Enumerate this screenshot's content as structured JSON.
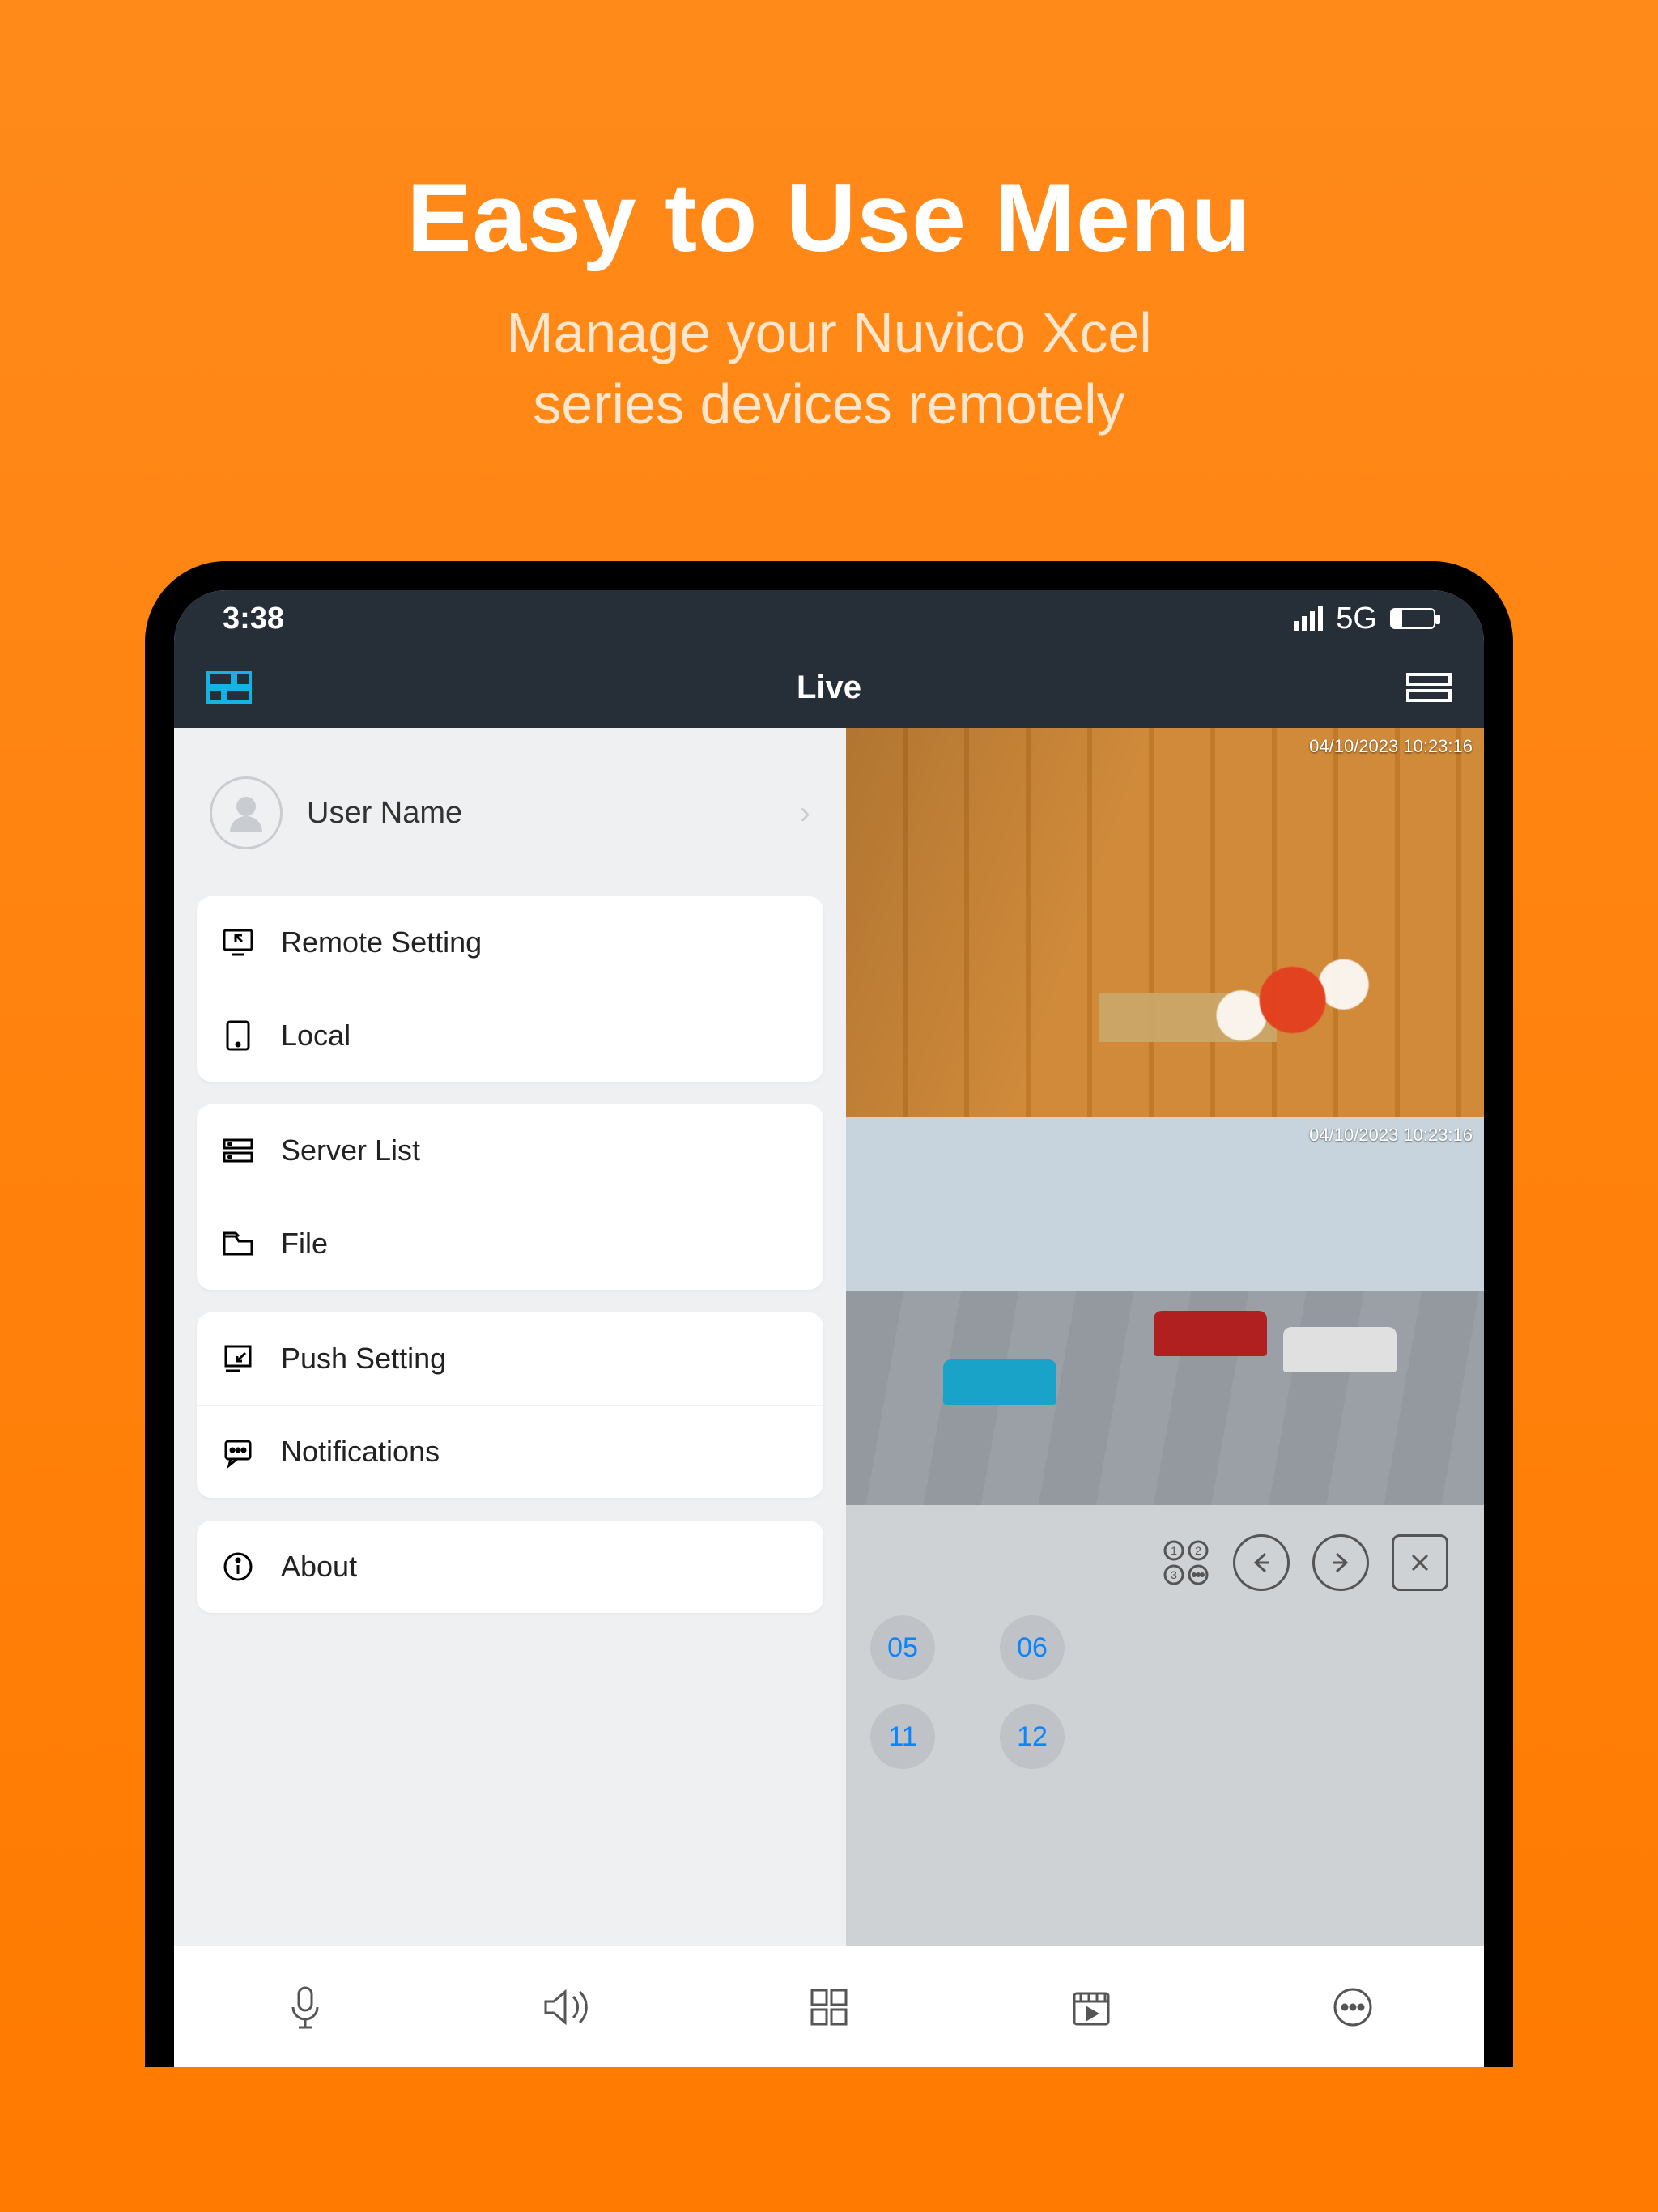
{
  "promo": {
    "title": "Easy to Use Menu",
    "subtitle_l1": "Manage your Nuvico Xcel",
    "subtitle_l2": "series devices remotely"
  },
  "status": {
    "time": "3:38",
    "network": "5G"
  },
  "header": {
    "title": "Live"
  },
  "user": {
    "name": "User Name"
  },
  "menu": {
    "group1": [
      {
        "icon": "remote-setting-icon",
        "label": "Remote Setting"
      },
      {
        "icon": "local-icon",
        "label": "Local"
      }
    ],
    "group2": [
      {
        "icon": "server-list-icon",
        "label": "Server List"
      },
      {
        "icon": "file-icon",
        "label": "File"
      }
    ],
    "group3": [
      {
        "icon": "push-setting-icon",
        "label": "Push Setting"
      },
      {
        "icon": "notifications-icon",
        "label": "Notifications"
      }
    ],
    "group4": [
      {
        "icon": "about-icon",
        "label": "About"
      }
    ]
  },
  "feeds": [
    {
      "timestamp": "04/10/2023  10:23:16"
    },
    {
      "timestamp": "04/10/2023  10:23:16"
    }
  ],
  "channels": [
    "05",
    "06",
    "11",
    "12"
  ],
  "tabbar_icons": [
    "mic-icon",
    "speaker-icon",
    "grid-icon",
    "record-icon",
    "more-icon"
  ]
}
